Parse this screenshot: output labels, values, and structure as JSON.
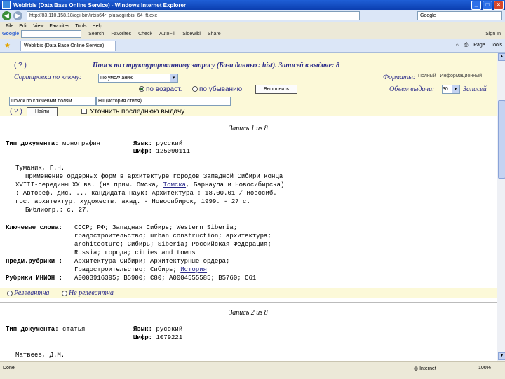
{
  "window": {
    "title": "WebIrbis (Data Base Online Service) - Windows Internet Explorer"
  },
  "address": {
    "url": "http://83.110.158.18/cgi-bin/irbis64r_plus/cgiirbis_64_ft.exe",
    "search_placeholder": "Google"
  },
  "menu": [
    "File",
    "Edit",
    "View",
    "Favorites",
    "Tools",
    "Help"
  ],
  "google_bar": {
    "logo": "Google",
    "items": [
      "Search",
      "Favorites",
      "Check",
      "AutoFill",
      "Sidewiki",
      "Share",
      "Sign In"
    ]
  },
  "tab": {
    "label": "WebIrbis (Data Base Online Service)",
    "page_label": "Page",
    "tools_label": "Tools"
  },
  "form": {
    "help": "( ? )",
    "header": "Поиск по структурированному запросу (База данных: hist). Записей в выдаче: 8",
    "sort_label": "Сортировка по ключу:",
    "sort_value": "По умолчанию",
    "formats_label": "Форматы:",
    "formats_options": "Полный | Информационный",
    "asc": "по возраст.",
    "desc": "по убыванию",
    "run_button": "Выполнить",
    "output_label": "Объем выдачи:",
    "output_count": "30",
    "output_suffix": "Записей",
    "field_select": "Поиск по ключевым полям",
    "query_value": "HIL(история стиля)",
    "help2": "( ? )",
    "find_button": "Найти",
    "refine": "Уточнить последнюю выдачу"
  },
  "record1": {
    "header": "Запись 1 из 8",
    "line1_label": "Тип документа:",
    "line1_value": " монография",
    "lang_label": "Язык:",
    "lang_value": " русский",
    "code_label": "Шифр:",
    "code_value": " 125090111",
    "author": "Туманик, Г.Н.",
    "body1": "Применение ордерных форм в архитектуре городов Западной Сибири конца",
    "body2": "XVIII-середины XX вв. (на прим. Омска, ",
    "body2_link": "Томска",
    "body2_tail": ", Барнаула и Новосибирска)",
    "body3": ": Автореф. дис. ... кандидата наук: Архитектура : 18.00.01 / Новосиб.",
    "body4": "гос. архитектур. художеств. акад. - Новосибирск, 1999. - 27 с.",
    "body5": "Библиогр.: с. 27.",
    "kw_label": "Ключевые слова:",
    "kw1": "СССР; РФ; Западная Сибирь; Western Siberia;",
    "kw2": "градостроительство; urban construction; архитектура;",
    "kw3": "architecture; Сибирь; Siberia; Российская Федерация;",
    "kw4": "Russia; города; cities and towns",
    "subj_label": "Предм.рубрики :",
    "subj1": "Архитектура Сибири; Архитектурные ордера;",
    "subj2": "Градостроительство; Сибирь; ",
    "subj2_link": "История",
    "inion_label": "Рубрики ИНИОН :",
    "inion_value": "А0003916395; В5900; С80; А0004555585; В5760; С61",
    "res_yes": "Релевантна",
    "res_no": "Не релевантна"
  },
  "record2": {
    "header": "Запись 2 из 8",
    "line1_label": "Тип документа:",
    "line1_value": " статья",
    "lang_label": "Язык:",
    "lang_value": " русский",
    "code_label": "Шифр:",
    "code_value": " 1079221",
    "author": "Матвеев, Д.М."
  },
  "status": {
    "text": "Done",
    "zone": "Internet",
    "zoom": "100%"
  }
}
